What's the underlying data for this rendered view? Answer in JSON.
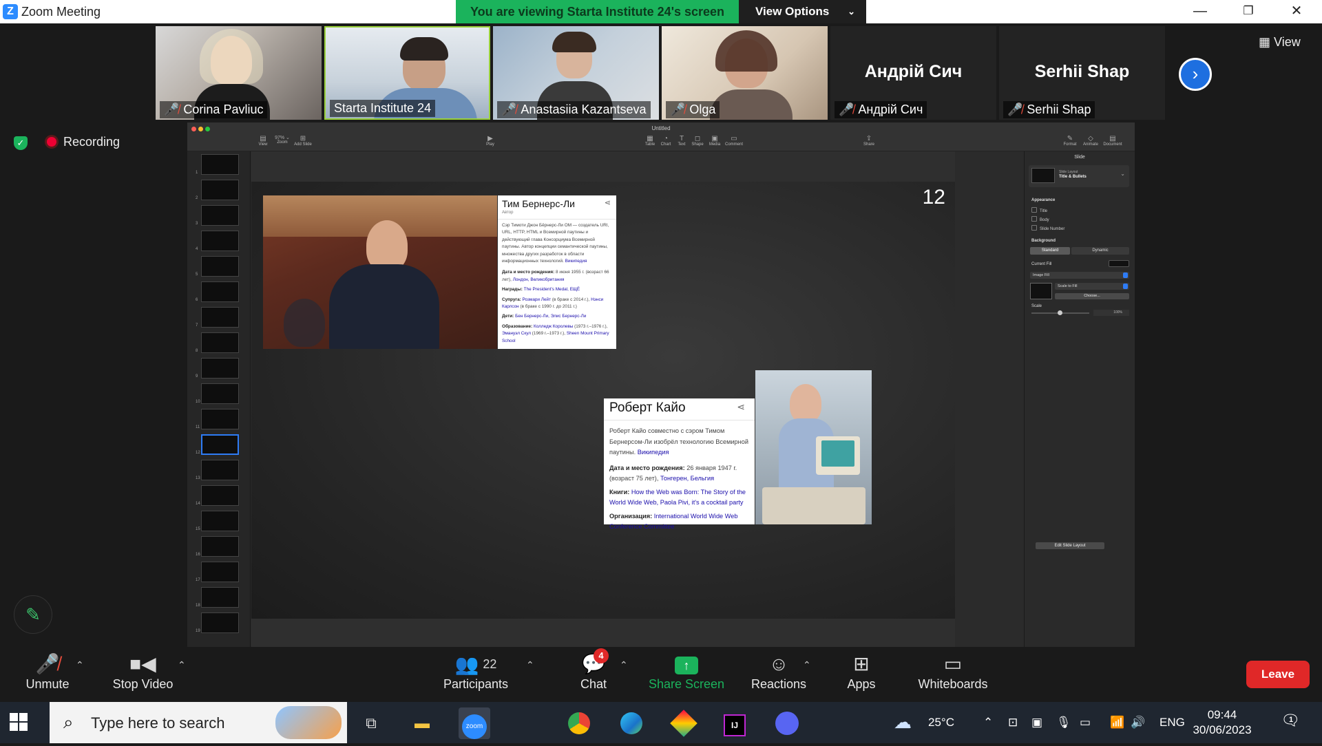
{
  "window": {
    "app_title": "Zoom Meeting",
    "banner": "You are viewing Starta Institute 24's screen",
    "view_options": "View Options",
    "minimize": "—",
    "restore": "❐",
    "close": "✕"
  },
  "participants": [
    {
      "name": "Corina Pavliuc",
      "muted": true,
      "video": true
    },
    {
      "name": "Starta Institute 24",
      "muted": false,
      "video": true,
      "active": true
    },
    {
      "name": "Anastasiia Kazantseva",
      "muted": true,
      "video": true
    },
    {
      "name": "Olga",
      "muted": true,
      "video": true
    },
    {
      "name": "Андрій Сич",
      "muted": true,
      "video": false
    },
    {
      "name": "Serhii Shap",
      "muted": true,
      "video": false
    }
  ],
  "strip": {
    "next_icon": "chevron-right-icon",
    "view_label": "View"
  },
  "status": {
    "recording": "Recording"
  },
  "keynote": {
    "doc_title": "Untitled",
    "toolbar_left": [
      {
        "label": "View",
        "icon": "▤"
      },
      {
        "label": "Zoom",
        "icon": "97% ⌄"
      },
      {
        "label": "Add Slide",
        "icon": "⊞"
      }
    ],
    "toolbar_play": {
      "label": "Play",
      "icon": "▶"
    },
    "toolbar_mid": [
      {
        "label": "Table",
        "icon": "▦"
      },
      {
        "label": "Chart",
        "icon": "◔"
      },
      {
        "label": "Text",
        "icon": "T"
      },
      {
        "label": "Shape",
        "icon": "◻"
      },
      {
        "label": "Media",
        "icon": "▣"
      },
      {
        "label": "Comment",
        "icon": "▭"
      }
    ],
    "toolbar_share": {
      "label": "Share",
      "icon": "⇪"
    },
    "toolbar_right": [
      {
        "label": "Format",
        "icon": "✎"
      },
      {
        "label": "Animate",
        "icon": "◇"
      },
      {
        "label": "Document",
        "icon": "▤"
      }
    ],
    "thumbnails": [
      "1",
      "2",
      "3",
      "4",
      "5",
      "6",
      "7",
      "8",
      "9",
      "10",
      "11",
      "12",
      "13",
      "14",
      "15",
      "16",
      "17",
      "18",
      "19"
    ],
    "selected_slide": 12,
    "slide_number": "12",
    "inspector": {
      "header": "Slide",
      "layout_label": "Slide Layout",
      "layout_value": "Title & Bullets",
      "appearance": "Appearance",
      "checkbox_title": "Title",
      "checkbox_body": "Body",
      "checkbox_slide_number": "Slide Number",
      "background": "Background",
      "seg_standard": "Standard",
      "seg_dynamic": "Dynamic",
      "current_fill": "Current Fill",
      "fill_type": "Image Fill",
      "scale_mode": "Scale to Fill",
      "choose": "Choose...",
      "scale": "Scale",
      "scale_value": "100%",
      "edit_layout": "Edit Slide Layout"
    }
  },
  "card1": {
    "name": "Тим Бернерс-Ли",
    "role": "Автор",
    "desc": "Сэр Тимоти Джон Бёрнерс-Ли OM — создатель URI, URL, HTTP, HTML и Всемирной паутины и действующий глава Консорциума Всемирной паутины. Автор концепции семантической паутины, множества других разработок в области информационных технологий.",
    "desc_link": "Википедия",
    "born_label": "Дата и место рождения:",
    "born_value": "8 июня 1955 г. (возраст 66 лет),",
    "born_link": "Лондон, Великобритания",
    "awards_label": "Награды:",
    "awards_link": "The President's Medal, ЕЩЁ",
    "spouse_label": "Супруга:",
    "spouse_link1": "Розмари Лейт",
    "spouse_text1": "(в браке с 2014 г.),",
    "spouse_link2": "Нэнси Карлсон",
    "spouse_text2": "(в браке с 1990 г. до 2011 г.)",
    "children_label": "Дети:",
    "children_link": "Бен Бернерс-Ли, Элис Бернерс-Ли",
    "edu_label": "Образование:",
    "edu_link1": "Колледж Королевы",
    "edu_text1": "(1973 г.–1976 г.),",
    "edu_link2": "Эмануэл Скул",
    "edu_text2": "(1969 г.–1973 г.),",
    "edu_link3": "Sheen Mount Primary School"
  },
  "card2": {
    "name": "Роберт Кайо",
    "desc": "Роберт Кайо совместно с сэром Тимом Бернерсом-Ли изобрёл технологию Всемирной паутины.",
    "desc_link": "Википедия",
    "born_label": "Дата и место рождения:",
    "born_value": "26 января 1947 г. (возраст 75 лет),",
    "born_link": "Тонгерен, Бельгия",
    "books_label": "Книги:",
    "books_link": "How the Web was Born: The Story of the World Wide Web, Paola Pivi, it's a cocktail party",
    "org_label": "Организация:",
    "org_link": "International World Wide Web Conference Committee"
  },
  "controls": {
    "unmute": "Unmute",
    "stop_video": "Stop Video",
    "participants_label": "Participants",
    "participants_count": "22",
    "chat": "Chat",
    "chat_badge": "4",
    "share_screen": "Share Screen",
    "reactions": "Reactions",
    "apps": "Apps",
    "whiteboards": "Whiteboards",
    "leave": "Leave",
    "accent": "#1bb35c"
  },
  "taskbar": {
    "search_placeholder": "Type here to search",
    "zoom_app": "zoom",
    "ij_app": "IJ",
    "temperature": "25°C",
    "language": "ENG",
    "time": "09:44",
    "date": "30/06/2023",
    "notifications": "1"
  }
}
